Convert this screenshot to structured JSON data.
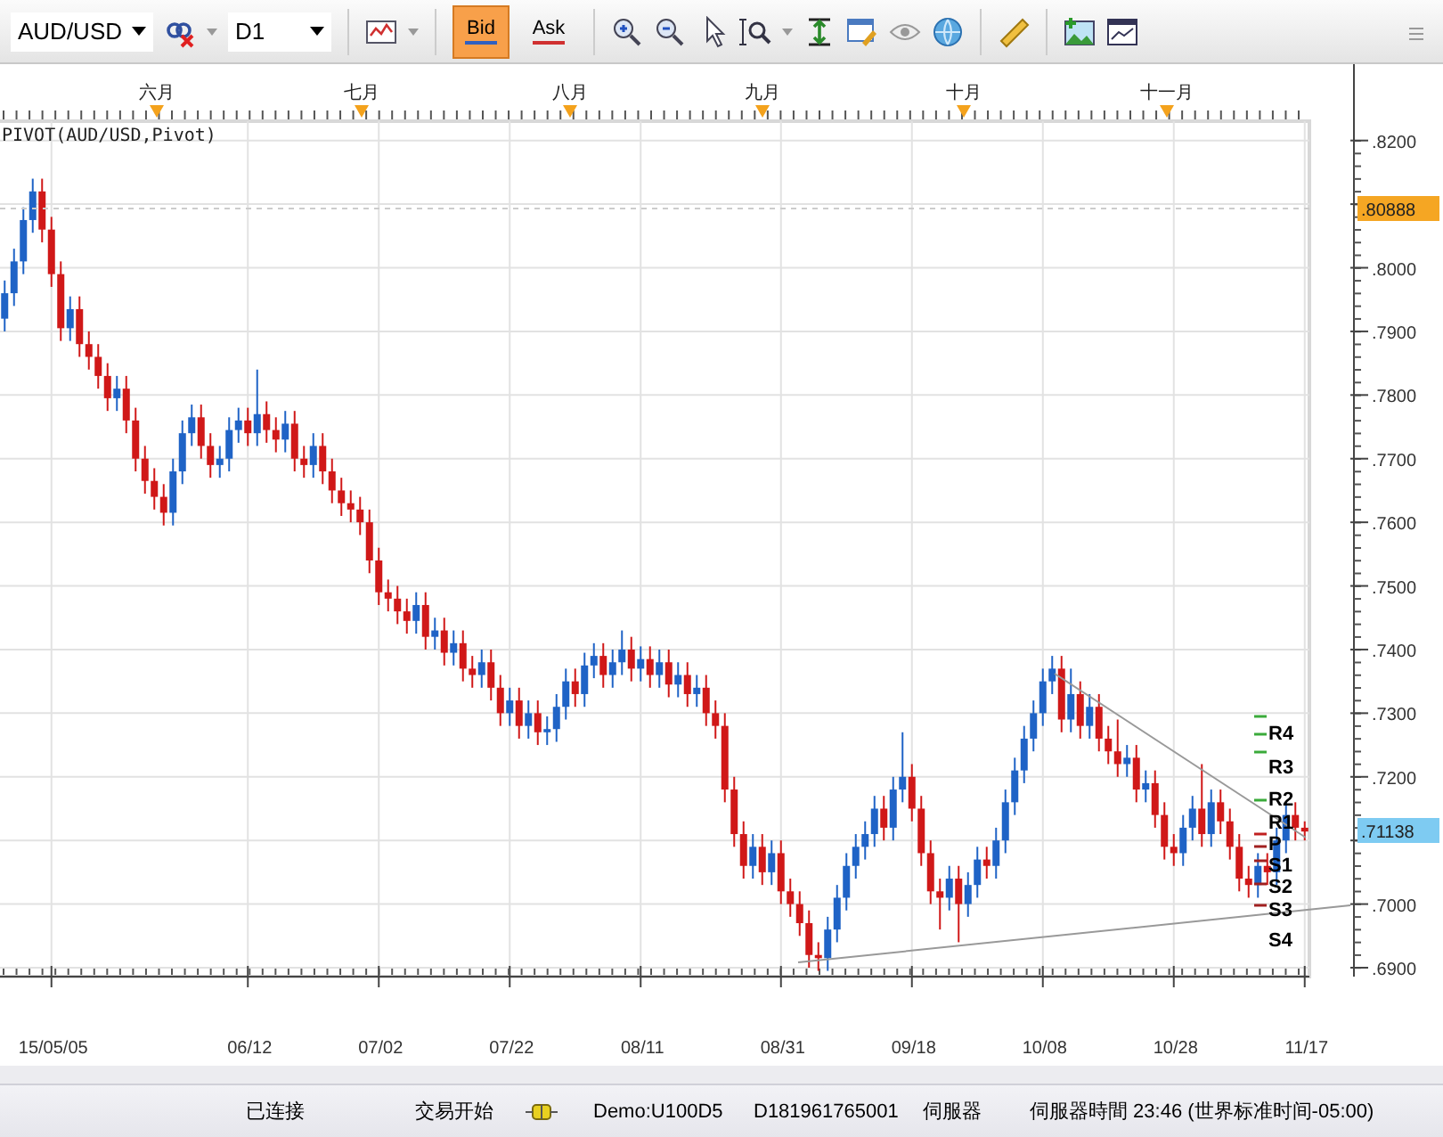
{
  "toolbar": {
    "symbol": "AUD/USD",
    "timeframe": "D1",
    "price_modes": [
      {
        "label": "Bid",
        "selected": true
      },
      {
        "label": "Ask",
        "selected": false
      }
    ]
  },
  "chart": {
    "title": "PIVOT(AUD/USD,Pivot)",
    "months": [
      "六月",
      "七月",
      "八月",
      "九月",
      "十月",
      "十一月"
    ],
    "chart_data": {
      "type": "candlestick",
      "ylim": [
        0.6886,
        0.832
      ],
      "categories": [
        null,
        null,
        null,
        null,
        null,
        "15/05/05",
        null,
        null,
        null,
        null,
        null,
        null,
        null,
        null,
        null,
        null,
        null,
        null,
        null,
        null,
        null,
        null,
        null,
        null,
        null,
        null,
        "06/12",
        null,
        null,
        null,
        null,
        null,
        null,
        null,
        null,
        null,
        null,
        null,
        null,
        null,
        "07/02",
        null,
        null,
        null,
        null,
        null,
        null,
        null,
        null,
        null,
        null,
        null,
        null,
        null,
        "07/22",
        null,
        null,
        null,
        null,
        null,
        null,
        null,
        null,
        null,
        null,
        null,
        null,
        null,
        "08/11",
        null,
        null,
        null,
        null,
        null,
        null,
        null,
        null,
        null,
        null,
        null,
        null,
        null,
        null,
        "08/31",
        null,
        null,
        null,
        null,
        null,
        null,
        null,
        null,
        null,
        null,
        null,
        null,
        null,
        "09/18",
        null,
        null,
        null,
        null,
        null,
        null,
        null,
        null,
        null,
        null,
        null,
        null,
        null,
        "10/08",
        null,
        null,
        null,
        null,
        null,
        null,
        null,
        null,
        null,
        null,
        null,
        null,
        null,
        "10/28",
        null,
        null,
        null,
        null,
        null,
        null,
        null,
        null,
        null,
        null,
        null,
        null,
        null,
        "11/17"
      ],
      "ohlc": [
        [
          0.792,
          0.798,
          0.79,
          0.796
        ],
        [
          0.796,
          0.803,
          0.794,
          0.801
        ],
        [
          0.801,
          0.8095,
          0.799,
          0.8075
        ],
        [
          0.8075,
          0.814,
          0.8055,
          0.812
        ],
        [
          0.812,
          0.814,
          0.804,
          0.806
        ],
        [
          0.806,
          0.808,
          0.797,
          0.799
        ],
        [
          0.799,
          0.801,
          0.7885,
          0.7905
        ],
        [
          0.7905,
          0.7955,
          0.7885,
          0.7935
        ],
        [
          0.7935,
          0.7955,
          0.786,
          0.788
        ],
        [
          0.788,
          0.79,
          0.784,
          0.786
        ],
        [
          0.786,
          0.788,
          0.781,
          0.783
        ],
        [
          0.783,
          0.785,
          0.7775,
          0.7795
        ],
        [
          0.7795,
          0.783,
          0.7775,
          0.781
        ],
        [
          0.781,
          0.783,
          0.774,
          0.776
        ],
        [
          0.776,
          0.778,
          0.768,
          0.77
        ],
        [
          0.77,
          0.772,
          0.7645,
          0.7665
        ],
        [
          0.7665,
          0.7685,
          0.762,
          0.764
        ],
        [
          0.764,
          0.766,
          0.7595,
          0.7615
        ],
        [
          0.7615,
          0.77,
          0.7595,
          0.768
        ],
        [
          0.768,
          0.776,
          0.766,
          0.774
        ],
        [
          0.774,
          0.7785,
          0.772,
          0.7765
        ],
        [
          0.7765,
          0.7785,
          0.77,
          0.772
        ],
        [
          0.772,
          0.774,
          0.767,
          0.769
        ],
        [
          0.769,
          0.772,
          0.767,
          0.77
        ],
        [
          0.77,
          0.7765,
          0.768,
          0.7745
        ],
        [
          0.7745,
          0.778,
          0.7725,
          0.776
        ],
        [
          0.776,
          0.778,
          0.772,
          0.774
        ],
        [
          0.774,
          0.784,
          0.772,
          0.777
        ],
        [
          0.777,
          0.779,
          0.7725,
          0.7745
        ],
        [
          0.7745,
          0.7765,
          0.771,
          0.773
        ],
        [
          0.773,
          0.7775,
          0.771,
          0.7755
        ],
        [
          0.7755,
          0.7775,
          0.768,
          0.77
        ],
        [
          0.77,
          0.772,
          0.767,
          0.769
        ],
        [
          0.769,
          0.774,
          0.767,
          0.772
        ],
        [
          0.772,
          0.774,
          0.766,
          0.768
        ],
        [
          0.768,
          0.77,
          0.763,
          0.765
        ],
        [
          0.765,
          0.767,
          0.761,
          0.763
        ],
        [
          0.763,
          0.765,
          0.76,
          0.762
        ],
        [
          0.762,
          0.764,
          0.758,
          0.76
        ],
        [
          0.76,
          0.762,
          0.752,
          0.754
        ],
        [
          0.754,
          0.756,
          0.747,
          0.749
        ],
        [
          0.749,
          0.751,
          0.746,
          0.748
        ],
        [
          0.748,
          0.75,
          0.744,
          0.746
        ],
        [
          0.746,
          0.748,
          0.7425,
          0.7445
        ],
        [
          0.7445,
          0.749,
          0.7425,
          0.747
        ],
        [
          0.747,
          0.749,
          0.74,
          0.742
        ],
        [
          0.742,
          0.745,
          0.74,
          0.743
        ],
        [
          0.743,
          0.745,
          0.7375,
          0.7395
        ],
        [
          0.7395,
          0.743,
          0.7375,
          0.741
        ],
        [
          0.741,
          0.743,
          0.735,
          0.737
        ],
        [
          0.737,
          0.739,
          0.734,
          0.736
        ],
        [
          0.736,
          0.74,
          0.734,
          0.738
        ],
        [
          0.738,
          0.74,
          0.732,
          0.734
        ],
        [
          0.734,
          0.736,
          0.728,
          0.73
        ],
        [
          0.73,
          0.734,
          0.728,
          0.732
        ],
        [
          0.732,
          0.734,
          0.726,
          0.728
        ],
        [
          0.728,
          0.732,
          0.726,
          0.73
        ],
        [
          0.73,
          0.732,
          0.725,
          0.727
        ],
        [
          0.727,
          0.7295,
          0.725,
          0.7275
        ],
        [
          0.7275,
          0.733,
          0.7255,
          0.731
        ],
        [
          0.731,
          0.737,
          0.729,
          0.735
        ],
        [
          0.735,
          0.737,
          0.731,
          0.733
        ],
        [
          0.733,
          0.7395,
          0.731,
          0.7375
        ],
        [
          0.7375,
          0.741,
          0.7355,
          0.739
        ],
        [
          0.739,
          0.741,
          0.734,
          0.736
        ],
        [
          0.736,
          0.74,
          0.734,
          0.738
        ],
        [
          0.738,
          0.743,
          0.736,
          0.74
        ],
        [
          0.74,
          0.742,
          0.735,
          0.737
        ],
        [
          0.737,
          0.7405,
          0.735,
          0.7385
        ],
        [
          0.7385,
          0.7405,
          0.734,
          0.736
        ],
        [
          0.736,
          0.74,
          0.734,
          0.738
        ],
        [
          0.738,
          0.74,
          0.7325,
          0.7345
        ],
        [
          0.7345,
          0.738,
          0.7325,
          0.736
        ],
        [
          0.736,
          0.738,
          0.731,
          0.733
        ],
        [
          0.733,
          0.736,
          0.731,
          0.734
        ],
        [
          0.734,
          0.736,
          0.728,
          0.73
        ],
        [
          0.73,
          0.732,
          0.726,
          0.728
        ],
        [
          0.728,
          0.73,
          0.716,
          0.718
        ],
        [
          0.718,
          0.72,
          0.709,
          0.711
        ],
        [
          0.711,
          0.713,
          0.704,
          0.706
        ],
        [
          0.706,
          0.711,
          0.704,
          0.709
        ],
        [
          0.709,
          0.711,
          0.703,
          0.705
        ],
        [
          0.705,
          0.71,
          0.703,
          0.708
        ],
        [
          0.708,
          0.71,
          0.7,
          0.702
        ],
        [
          0.702,
          0.704,
          0.698,
          0.7
        ],
        [
          0.7,
          0.702,
          0.695,
          0.697
        ],
        [
          0.697,
          0.699,
          0.69,
          0.692
        ],
        [
          0.692,
          0.694,
          0.6895,
          0.6915
        ],
        [
          0.6915,
          0.698,
          0.6895,
          0.696
        ],
        [
          0.696,
          0.703,
          0.694,
          0.701
        ],
        [
          0.701,
          0.708,
          0.699,
          0.706
        ],
        [
          0.706,
          0.711,
          0.704,
          0.709
        ],
        [
          0.709,
          0.713,
          0.707,
          0.711
        ],
        [
          0.711,
          0.717,
          0.709,
          0.715
        ],
        [
          0.715,
          0.717,
          0.71,
          0.712
        ],
        [
          0.712,
          0.72,
          0.71,
          0.718
        ],
        [
          0.718,
          0.727,
          0.716,
          0.72
        ],
        [
          0.72,
          0.722,
          0.713,
          0.715
        ],
        [
          0.715,
          0.717,
          0.706,
          0.708
        ],
        [
          0.708,
          0.71,
          0.7,
          0.702
        ],
        [
          0.702,
          0.704,
          0.696,
          0.701
        ],
        [
          0.701,
          0.706,
          0.699,
          0.704
        ],
        [
          0.704,
          0.706,
          0.694,
          0.7
        ],
        [
          0.7,
          0.705,
          0.698,
          0.703
        ],
        [
          0.703,
          0.709,
          0.701,
          0.707
        ],
        [
          0.707,
          0.709,
          0.704,
          0.706
        ],
        [
          0.706,
          0.712,
          0.704,
          0.71
        ],
        [
          0.71,
          0.718,
          0.708,
          0.716
        ],
        [
          0.716,
          0.723,
          0.714,
          0.721
        ],
        [
          0.721,
          0.728,
          0.719,
          0.726
        ],
        [
          0.726,
          0.732,
          0.724,
          0.73
        ],
        [
          0.73,
          0.737,
          0.728,
          0.735
        ],
        [
          0.735,
          0.739,
          0.733,
          0.737
        ],
        [
          0.737,
          0.739,
          0.727,
          0.729
        ],
        [
          0.729,
          0.737,
          0.727,
          0.733
        ],
        [
          0.733,
          0.735,
          0.726,
          0.728
        ],
        [
          0.728,
          0.733,
          0.726,
          0.731
        ],
        [
          0.731,
          0.733,
          0.724,
          0.726
        ],
        [
          0.726,
          0.728,
          0.722,
          0.724
        ],
        [
          0.724,
          0.729,
          0.72,
          0.722
        ],
        [
          0.722,
          0.725,
          0.72,
          0.723
        ],
        [
          0.723,
          0.725,
          0.716,
          0.718
        ],
        [
          0.718,
          0.721,
          0.716,
          0.719
        ],
        [
          0.719,
          0.721,
          0.712,
          0.714
        ],
        [
          0.714,
          0.716,
          0.707,
          0.709
        ],
        [
          0.709,
          0.711,
          0.706,
          0.708
        ],
        [
          0.708,
          0.714,
          0.706,
          0.712
        ],
        [
          0.712,
          0.717,
          0.71,
          0.715
        ],
        [
          0.715,
          0.722,
          0.709,
          0.711
        ],
        [
          0.711,
          0.718,
          0.709,
          0.716
        ],
        [
          0.716,
          0.718,
          0.711,
          0.713
        ],
        [
          0.713,
          0.715,
          0.707,
          0.709
        ],
        [
          0.709,
          0.711,
          0.702,
          0.704
        ],
        [
          0.704,
          0.706,
          0.701,
          0.703
        ],
        [
          0.703,
          0.708,
          0.701,
          0.706
        ],
        [
          0.706,
          0.708,
          0.703,
          0.705
        ],
        [
          0.705,
          0.712,
          0.703,
          0.71
        ],
        [
          0.71,
          0.716,
          0.708,
          0.714
        ],
        [
          0.714,
          0.716,
          0.71,
          0.712
        ],
        [
          0.712,
          0.713,
          0.71,
          0.7114
        ]
      ],
      "yticks": [
        {
          "value": 0.82,
          "label": ".8200"
        },
        {
          "value": 0.8,
          "label": ".8000"
        },
        {
          "value": 0.79,
          "label": ".7900"
        },
        {
          "value": 0.78,
          "label": ".7800"
        },
        {
          "value": 0.77,
          "label": ".7700"
        },
        {
          "value": 0.76,
          "label": ".7600"
        },
        {
          "value": 0.75,
          "label": ".7500"
        },
        {
          "value": 0.74,
          "label": ".7400"
        },
        {
          "value": 0.73,
          "label": ".7300"
        },
        {
          "value": 0.72,
          "label": ".7200"
        },
        {
          "value": 0.7,
          "label": ".7000"
        },
        {
          "value": 0.69,
          "label": ".6900"
        }
      ],
      "grid": true
    },
    "price_tags": [
      {
        "label": ".80888",
        "color": "#f5a623"
      },
      {
        "label": ".71138",
        "color": "#7ecbf2"
      }
    ],
    "pivot_levels": [
      {
        "label": "R4",
        "kind": "resistance"
      },
      {
        "label": "R3",
        "kind": "resistance"
      },
      {
        "label": "R2",
        "kind": "resistance"
      },
      {
        "label": "R1",
        "kind": "resistance"
      },
      {
        "label": "P",
        "kind": "pivot"
      },
      {
        "label": "S1",
        "kind": "support"
      },
      {
        "label": "S2",
        "kind": "support"
      },
      {
        "label": "S3",
        "kind": "support"
      },
      {
        "label": "S4",
        "kind": "support"
      }
    ]
  },
  "status_bar": {
    "connection": "已连接",
    "trading": "交易开始",
    "account": "Demo:U100D5",
    "account_id": "D181961765001",
    "server": "伺服器",
    "server_time": "伺服器時間 23:46 (世界标准时间-05:00)"
  }
}
